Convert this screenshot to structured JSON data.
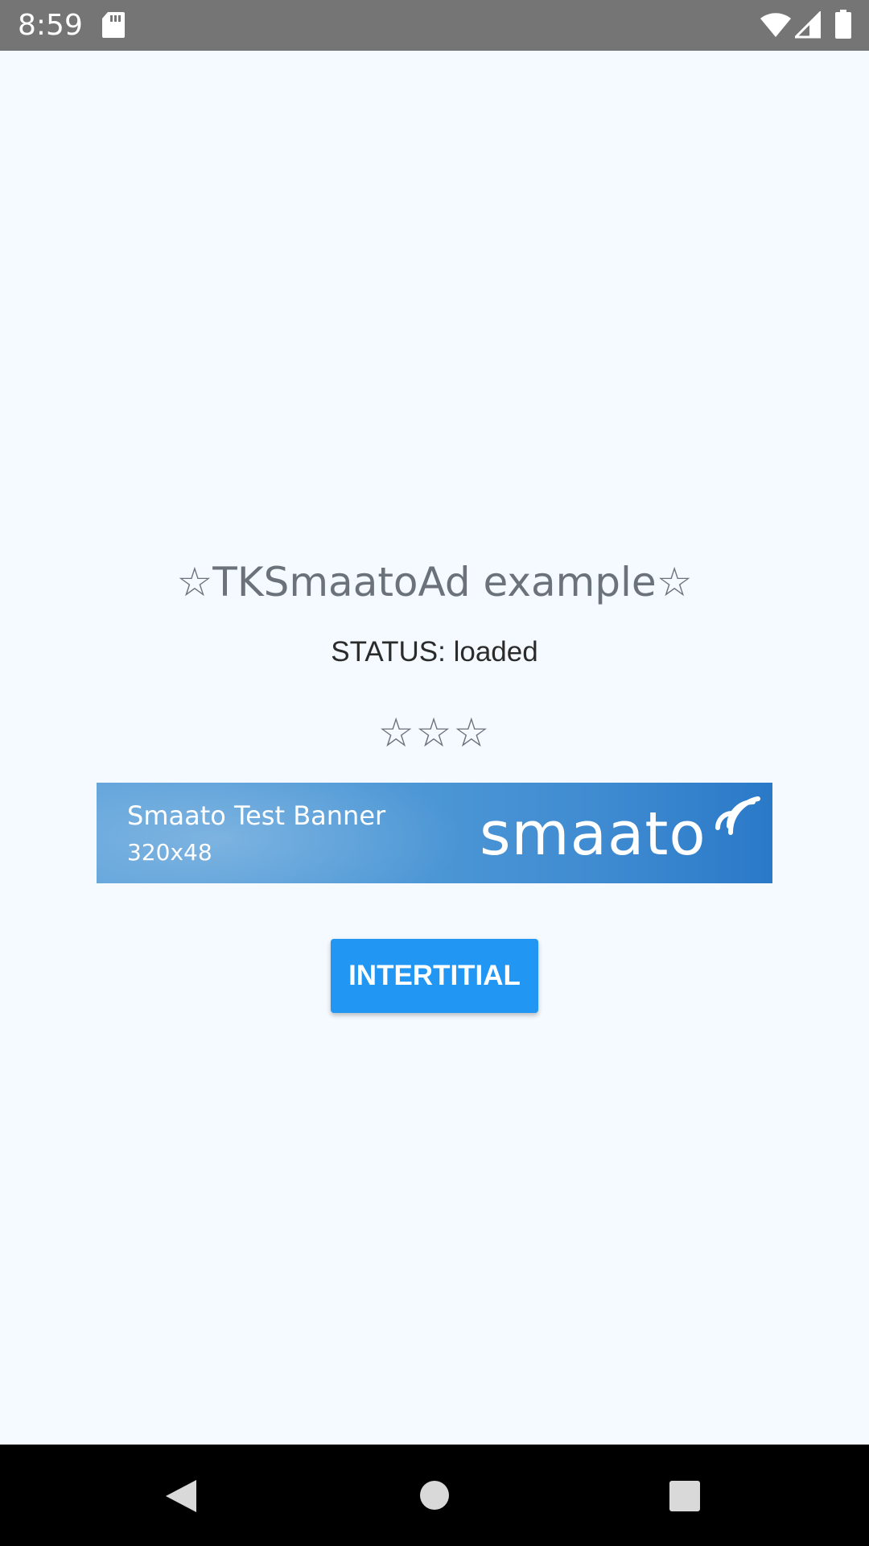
{
  "status_bar": {
    "time": "8:59",
    "icons": [
      "sd-card-icon",
      "wifi-icon",
      "cell-signal-icon",
      "battery-icon"
    ]
  },
  "main": {
    "title": "☆TKSmaatoAd example☆",
    "status": "STATUS: loaded",
    "stars": "☆☆☆",
    "banner": {
      "title": "Smaato Test Banner",
      "size": "320x48",
      "logo": "smaato"
    },
    "interstitial_button": "INTERTITIAL"
  },
  "nav_bar": {
    "buttons": [
      "back-icon",
      "home-icon",
      "recents-icon"
    ]
  },
  "colors": {
    "status_bar": "#757575",
    "background": "#f4faff",
    "button": "#2196f3",
    "title_text": "#6b7279",
    "banner": "#4e98d6"
  }
}
